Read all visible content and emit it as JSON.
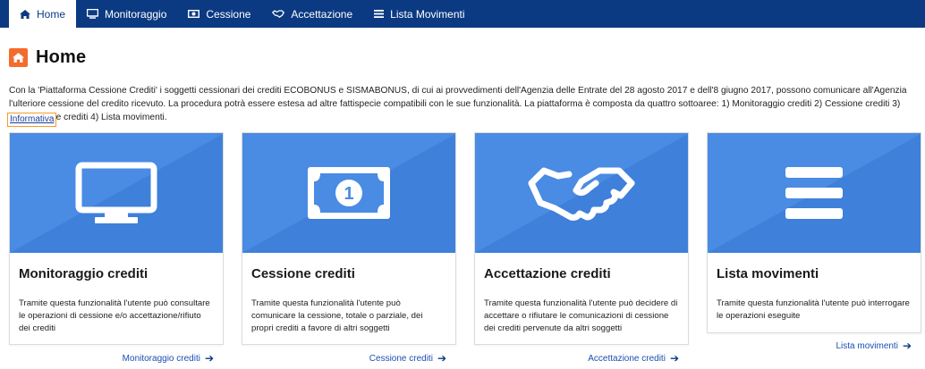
{
  "nav": {
    "items": [
      {
        "label": "Home",
        "icon": "home-icon",
        "active": true
      },
      {
        "label": "Monitoraggio",
        "icon": "monitor-icon",
        "active": false
      },
      {
        "label": "Cessione",
        "icon": "banknote-icon",
        "active": false
      },
      {
        "label": "Accettazione",
        "icon": "handshake-icon",
        "active": false
      },
      {
        "label": "Lista Movimenti",
        "icon": "list-icon",
        "active": false
      }
    ]
  },
  "page": {
    "title": "Home",
    "intro": "Con la 'Piattaforma Cessione Crediti' i soggetti cessionari dei crediti ECOBONUS e SISMABONUS, di cui ai provvedimenti dell'Agenzia delle Entrate del 28 agosto 2017 e dell'8 giugno 2017, possono comunicare all'Agenzia l'ulteriore cessione del credito ricevuto. La procedura potrà essere estesa ad altre fattispecie compatibili con le sue funzionalità. La piattaforma è composta da quattro sottoaree: 1) Monitoraggio crediti 2) Cessione crediti 3) Accettazione crediti 4) Lista movimenti.",
    "info_link": "Informativa"
  },
  "cards": [
    {
      "title": "Monitoraggio crediti",
      "description": "Tramite questa funzionalità l'utente può consultare le operazioni di cessione e/o accettazione/rifiuto dei crediti",
      "link": "Monitoraggio crediti",
      "icon": "monitor-icon"
    },
    {
      "title": "Cessione crediti",
      "description": "Tramite questa funzionalità l'utente può comunicare la cessione, totale o parziale, dei propri crediti a favore di altri soggetti",
      "link": "Cessione crediti",
      "icon": "banknote-icon"
    },
    {
      "title": "Accettazione crediti",
      "description": "Tramite questa funzionalità l'utente può decidere di accettare o rifiutare le comunicazioni di cessione dei crediti pervenute da altri soggetti",
      "link": "Accettazione crediti",
      "icon": "handshake-icon"
    },
    {
      "title": "Lista movimenti",
      "description": "Tramite questa funzionalità l'utente può interrogare le operazioni eseguite",
      "link": "Lista movimenti",
      "icon": "list-icon"
    }
  ],
  "colors": {
    "nav_bg": "#0b3a82",
    "accent_orange": "#f46b2c",
    "card_blue": "#4a8be3",
    "link_blue": "#1a4fb0"
  }
}
